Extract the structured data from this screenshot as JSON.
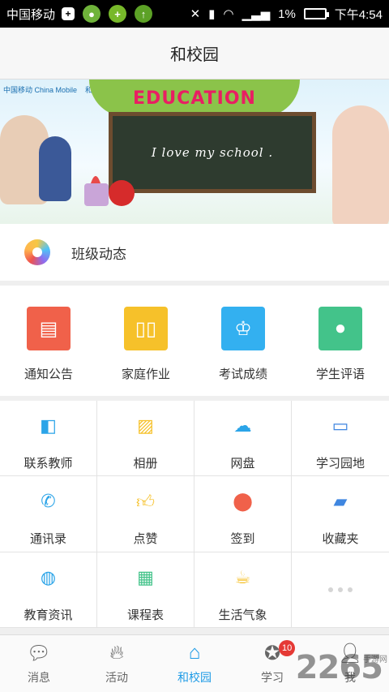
{
  "status_bar": {
    "carrier": "中国移动",
    "battery": "1%",
    "time": "下午4:54"
  },
  "header": {
    "title": "和校园"
  },
  "banner": {
    "logo_1": "中国移动 China Mobile",
    "logo_2": "和教育",
    "title": "EDUCATION",
    "board_text": "I  love  my  school ."
  },
  "class_news": {
    "label": "班级动态"
  },
  "main_items": [
    {
      "label": "通知公告",
      "color": "#f0614a",
      "icon": "clipboard-icon"
    },
    {
      "label": "家庭作业",
      "color": "#f6c12a",
      "icon": "book-icon"
    },
    {
      "label": "考试成绩",
      "color": "#33b0f0",
      "icon": "trophy-icon"
    },
    {
      "label": "学生评语",
      "color": "#43c38a",
      "icon": "comment-icon"
    }
  ],
  "sub_items": [
    {
      "label": "联系教师",
      "icon": "contact-teacher-icon",
      "color": "#2ba4e8"
    },
    {
      "label": "相册",
      "icon": "photo-album-icon",
      "color": "#f6c12a"
    },
    {
      "label": "网盘",
      "icon": "cloud-download-icon",
      "color": "#2ba4e8"
    },
    {
      "label": "学习园地",
      "icon": "monitor-icon",
      "color": "#3f86e0"
    },
    {
      "label": "通讯录",
      "icon": "address-book-icon",
      "color": "#2ba4e8"
    },
    {
      "label": "点赞",
      "icon": "thumbs-up-icon",
      "color": "#f6c12a"
    },
    {
      "label": "签到",
      "icon": "location-pin-icon",
      "color": "#f0614a"
    },
    {
      "label": "收藏夹",
      "icon": "folder-icon",
      "color": "#3f86e0"
    },
    {
      "label": "教育资讯",
      "icon": "basketball-icon",
      "color": "#2ba4e8"
    },
    {
      "label": "课程表",
      "icon": "calendar-icon",
      "color": "#43c38a"
    },
    {
      "label": "生活气象",
      "icon": "coffee-cup-icon",
      "color": "#f6c12a"
    }
  ],
  "tabs": [
    {
      "label": "消息",
      "icon": "chat-bubble-icon",
      "active": false
    },
    {
      "label": "活动",
      "icon": "flame-icon",
      "active": false
    },
    {
      "label": "和校园",
      "icon": "home-icon",
      "active": true
    },
    {
      "label": "学习",
      "icon": "ribbon-icon",
      "active": false,
      "badge": "10"
    },
    {
      "label": "我",
      "icon": "person-icon",
      "active": false
    }
  ],
  "watermark": {
    "text": "2265",
    "sub": "手游网"
  }
}
